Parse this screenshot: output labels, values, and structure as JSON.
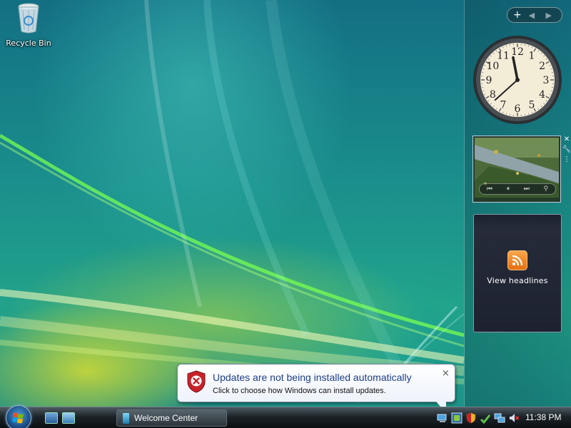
{
  "desktop": {
    "icons": [
      {
        "label": "Recycle Bin",
        "icon": "recycle-bin-icon"
      }
    ]
  },
  "sidebar": {
    "controls": {
      "add_label": "+",
      "nav_label": "◀ ▶"
    },
    "clock": {
      "hour_labels": [
        "12",
        "1",
        "2",
        "3",
        "4",
        "5",
        "6",
        "7",
        "8",
        "9",
        "10",
        "11"
      ],
      "time": "11:38"
    },
    "slideshow": {
      "icon": "landscape-photo"
    },
    "feed": {
      "label": "View headlines",
      "icon": "rss-icon"
    }
  },
  "notification": {
    "title": "Updates are not being installed automatically",
    "message": "Click to choose how Windows can install updates.",
    "close_label": "×",
    "icon": "shield-error-icon"
  },
  "taskbar": {
    "start_icon": "windows-orb",
    "quick_launch": [
      "show-desktop-icon",
      "switch-windows-icon"
    ],
    "windows": [
      {
        "label": "Welcome Center",
        "icon": "welcome-center-icon"
      }
    ],
    "tray_icons": [
      "network-icon",
      "computer-icon",
      "security-alert-icon",
      "update-icon",
      "network-connection-icon",
      "volume-muted-icon"
    ],
    "clock": "11:38 PM"
  },
  "colors": {
    "taskbar": "#1c2328",
    "balloon_title": "#1e3d8a",
    "error_red": "#c8232a"
  }
}
